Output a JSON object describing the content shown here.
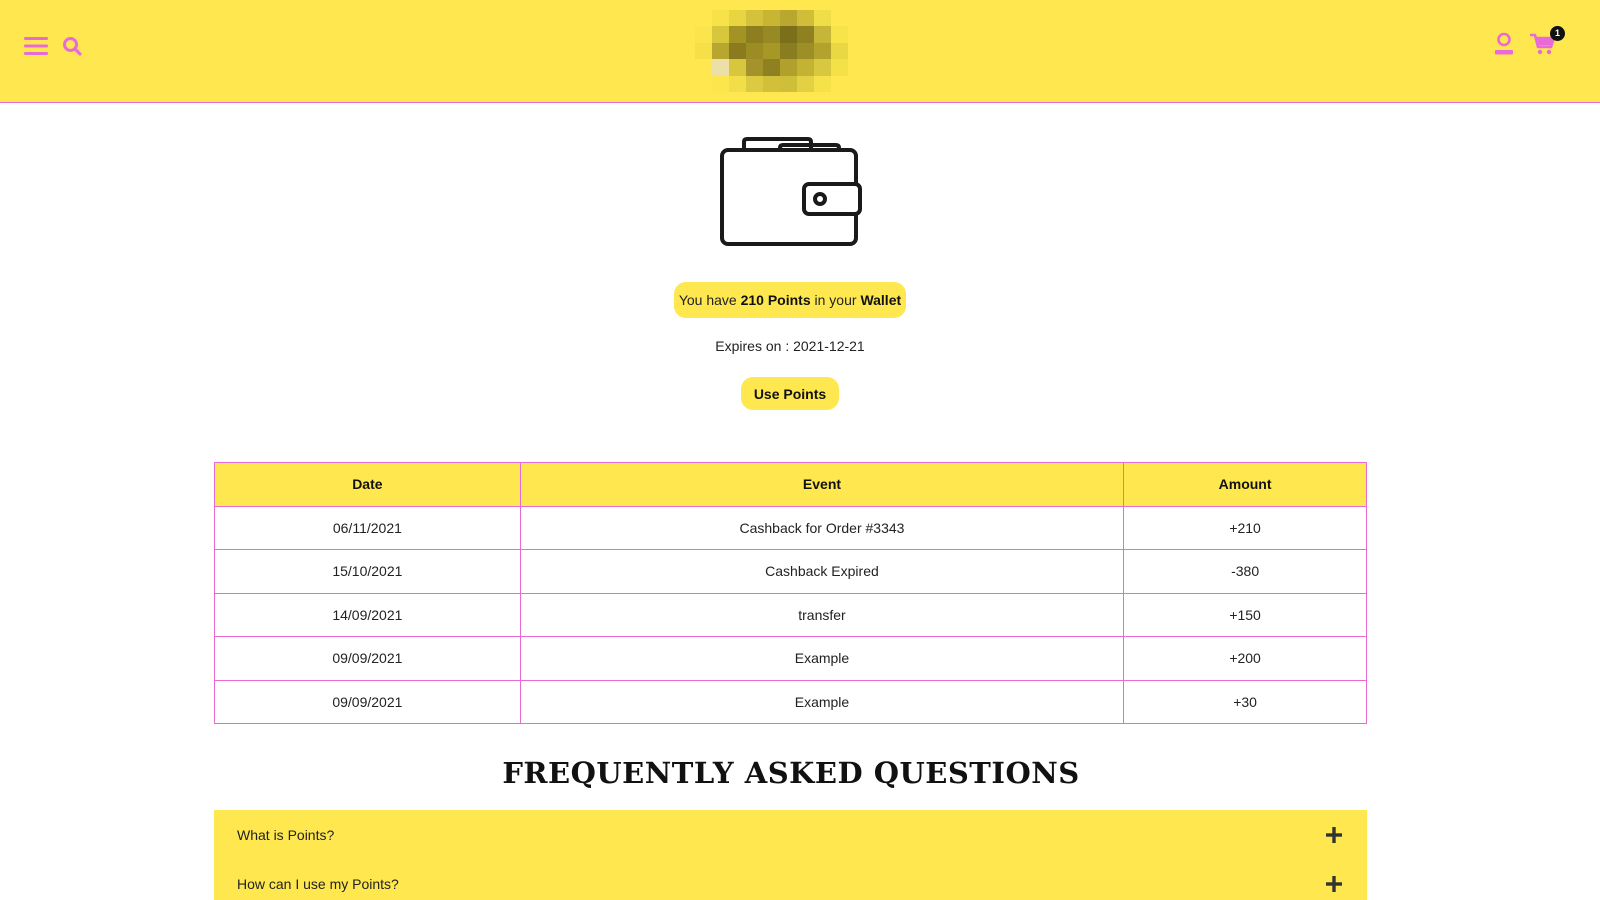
{
  "header": {
    "cart_count": "1",
    "colors": {
      "bar": "#ffe84f",
      "accent": "#e86ad7"
    },
    "icons": [
      "hamburger-menu-icon",
      "search-icon",
      "user-icon",
      "cart-icon"
    ]
  },
  "wallet": {
    "icon": "wallet-icon",
    "prefix": "You have ",
    "points": "210 Points",
    "middle": " in your ",
    "wallet_word": "Wallet",
    "expires": "Expires on : 2021-12-21",
    "use_points_label": "Use Points"
  },
  "history": {
    "columns": [
      "Date",
      "Event",
      "Amount"
    ],
    "rows": [
      [
        "06/11/2021",
        "Cashback for Order #3343",
        "+210"
      ],
      [
        "15/10/2021",
        "Cashback Expired",
        "-380"
      ],
      [
        "14/09/2021",
        "transfer",
        "+150"
      ],
      [
        "09/09/2021",
        "Example",
        "+200"
      ],
      [
        "09/09/2021",
        "Example",
        "+30"
      ]
    ]
  },
  "faq": {
    "title": "FREQUENTLY ASKED QUESTIONS",
    "items": [
      "What is Points?",
      "How can I use my Points?"
    ]
  }
}
